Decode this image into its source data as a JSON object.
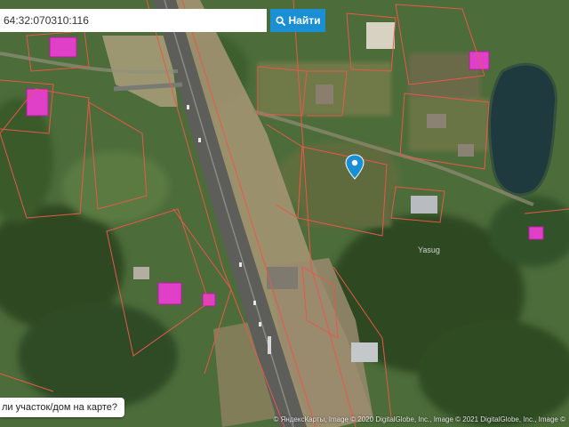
{
  "search": {
    "value": "64:32:070310:116",
    "button_label": "Найти",
    "button_icon": "search-icon"
  },
  "question_link": "ли участок/дом на карте?",
  "map": {
    "place_label": "Yasug",
    "marker_icon": "map-pin-icon",
    "attribution": "© ЯндексКарты, Image © 2020 DigitalGlobe, Inc., Image © 2021 DigitalGlobe, Inc., Image ©",
    "colors": {
      "vegetation": "#4a6b3a",
      "parcel_border": "#e8584a",
      "building_highlight": "#e040c8",
      "road": "#5c5c5a",
      "marker": "#1a8fd4",
      "water": "#1f3a3f"
    }
  }
}
